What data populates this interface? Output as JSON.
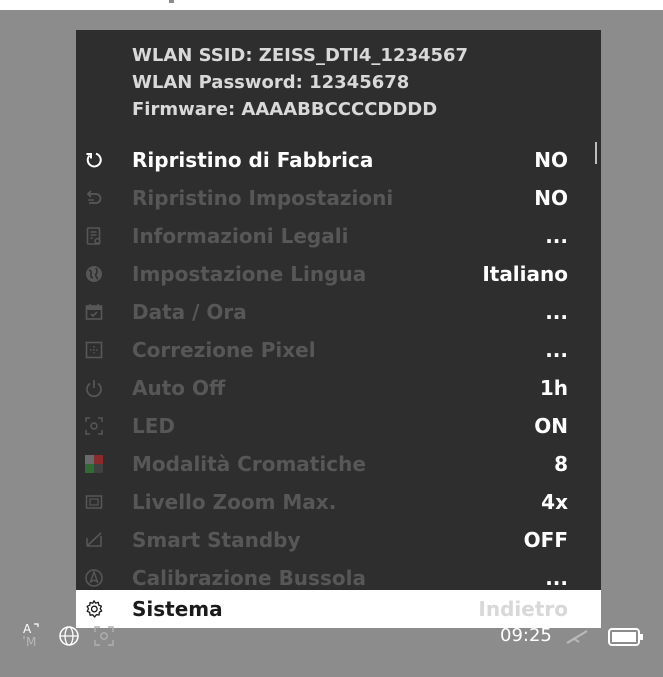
{
  "info": {
    "ssid": "WLAN SSID: ZEISS_DTI4_1234567",
    "password": "WLAN Password: 12345678",
    "firmware": "Firmware: AAAABBCCCCDDDD"
  },
  "menu": [
    {
      "label": "Ripristino di Fabbrica",
      "value": "NO",
      "icon": "reset-icon",
      "active": true
    },
    {
      "label": "Ripristino Impostazioni",
      "value": "NO",
      "icon": "undo-icon",
      "active": false
    },
    {
      "label": "Informazioni Legali",
      "value": "...",
      "icon": "legal-document-icon",
      "active": false
    },
    {
      "label": "Impostazione Lingua",
      "value": "Italiano",
      "icon": "globe-icon",
      "active": false
    },
    {
      "label": "Data / Ora",
      "value": "...",
      "icon": "calendar-icon",
      "active": false
    },
    {
      "label": "Correzione Pixel",
      "value": "...",
      "icon": "pixel-icon",
      "active": false
    },
    {
      "label": "Auto Off",
      "value": "1h",
      "icon": "power-icon",
      "active": false
    },
    {
      "label": "LED",
      "value": "ON",
      "icon": "led-icon",
      "active": false
    },
    {
      "label": "Modalità Cromatiche",
      "value": "8",
      "icon": "color-modes-icon",
      "active": false
    },
    {
      "label": "Livello Zoom Max.",
      "value": "4x",
      "icon": "zoom-icon",
      "active": false
    },
    {
      "label": "Smart Standby",
      "value": "OFF",
      "icon": "standby-icon",
      "active": false
    },
    {
      "label": "Calibrazione Bussola",
      "value": "...",
      "icon": "compass-icon",
      "active": false
    }
  ],
  "footer": {
    "label": "Sistema",
    "value": "Indietro",
    "icon": "gear-icon"
  },
  "status": {
    "mode_letters": "A M",
    "time": "09:25",
    "icons": [
      "auto-mode-icon",
      "globe-icon",
      "led-icon",
      "compass-icon",
      "battery-icon"
    ]
  },
  "colors": {
    "background": "#8c8c8c",
    "panel": "#2e2e2e",
    "text_active": "#ffffff",
    "text_dim": "#575757",
    "info_text": "#d9d9d9",
    "footer_bg": "#ffffff",
    "footer_value": "#d8d8d8"
  }
}
